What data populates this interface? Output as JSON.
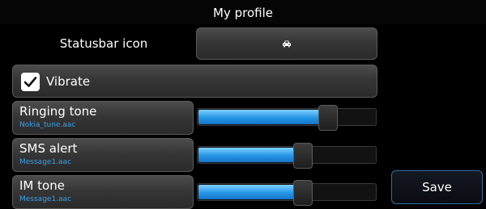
{
  "header": {
    "title": "My profile"
  },
  "statusbar": {
    "label": "Statusbar icon",
    "icon": "car-icon"
  },
  "vibrate": {
    "label": "Vibrate",
    "checked": true
  },
  "tones": [
    {
      "title": "Ringing tone",
      "file": "Nokia_tune.aac",
      "level": 0.73
    },
    {
      "title": "SMS alert",
      "file": "Message1.aac",
      "level": 0.59
    },
    {
      "title": "IM tone",
      "file": "Message1.aac",
      "level": 0.59
    }
  ],
  "save": {
    "label": "Save"
  },
  "colors": {
    "accent": "#2596e6",
    "subtext": "#3aa0e8",
    "background": "#000000"
  }
}
